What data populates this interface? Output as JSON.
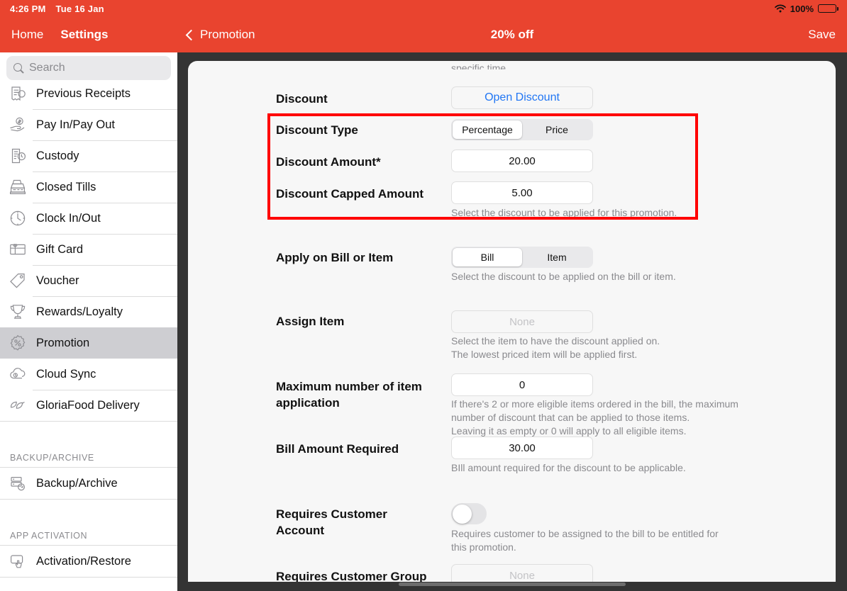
{
  "status_bar": {
    "time": "4:26 PM",
    "date": "Tue 16 Jan",
    "battery_percent": "100%",
    "wifi_icon": "wifi-icon",
    "battery_icon": "battery-full-icon"
  },
  "sidebar_header": {
    "home_label": "Home",
    "settings_label": "Settings"
  },
  "navbar": {
    "back_label": "Promotion",
    "back_icon": "chevron-left-icon",
    "title": "20% off",
    "save_label": "Save"
  },
  "search": {
    "placeholder": "Search",
    "icon": "search-icon",
    "value": ""
  },
  "sidebar": {
    "items": [
      {
        "label": "Previous Receipts",
        "icon": "receipt-icon",
        "selected": false
      },
      {
        "label": "Pay In/Pay Out",
        "icon": "hand-money-icon",
        "selected": false
      },
      {
        "label": "Custody",
        "icon": "document-clock-icon",
        "selected": false
      },
      {
        "label": "Closed Tills",
        "icon": "cash-register-icon",
        "selected": false
      },
      {
        "label": "Clock In/Out",
        "icon": "clock-icon",
        "selected": false
      },
      {
        "label": "Gift Card",
        "icon": "gift-card-icon",
        "selected": false
      },
      {
        "label": "Voucher",
        "icon": "tag-icon",
        "selected": false
      },
      {
        "label": "Rewards/Loyalty",
        "icon": "trophy-icon",
        "selected": false
      },
      {
        "label": "Promotion",
        "icon": "percent-badge-icon",
        "selected": true
      },
      {
        "label": "Cloud Sync",
        "icon": "cloud-sync-icon",
        "selected": false
      },
      {
        "label": "GloriaFood Delivery",
        "icon": "leaf-icon",
        "selected": false
      }
    ],
    "groups": [
      {
        "title": "BACKUP/ARCHIVE",
        "items": [
          {
            "label": "Backup/Archive",
            "icon": "server-backup-icon",
            "selected": false
          }
        ]
      },
      {
        "title": "APP ACTIVATION",
        "items": [
          {
            "label": "Activation/Restore",
            "icon": "tap-screen-icon",
            "selected": false
          }
        ]
      }
    ]
  },
  "form": {
    "clipped_top_text": "specific time.",
    "discount": {
      "label": "Discount",
      "button_label": "Open Discount"
    },
    "discount_type": {
      "label": "Discount Type",
      "options": [
        "Percentage",
        "Price"
      ],
      "selected": "Percentage"
    },
    "discount_amount": {
      "label": "Discount Amount*",
      "value": "20.00"
    },
    "discount_capped_amount": {
      "label": "Discount Capped Amount",
      "value": "5.00",
      "hint": "Select the discount to be applied for this promotion."
    },
    "apply_on": {
      "label": "Apply on Bill or Item",
      "options": [
        "Bill",
        "Item"
      ],
      "selected": "Bill",
      "hint": "Select the discount to be applied on the bill or item."
    },
    "assign_item": {
      "label": "Assign Item",
      "value": "None",
      "hint": "Select the item to have the discount applied on.\nThe lowest priced item will be applied first."
    },
    "max_item_application": {
      "label": "Maximum number of item application",
      "value": "0",
      "hint": "If there's 2 or more eligible items ordered in the bill, the maximum\nnumber of discount that can be applied to those items.\nLeaving it as empty or 0 will apply to all eligible items."
    },
    "bill_amount_required": {
      "label": "Bill Amount Required",
      "value": "30.00",
      "hint": "BIll amount required for the discount to be applicable."
    },
    "requires_customer_account": {
      "label": "Requires Customer Account",
      "toggle_on": false,
      "hint": "Requires customer to be assigned to the bill to be entitled for\nthis promotion."
    },
    "requires_customer_group": {
      "label": "Requires Customer Group",
      "value": "None"
    }
  },
  "annotation": {
    "color": "#FF0000",
    "highlighted_fields": [
      "Discount Type",
      "Discount Amount*",
      "Discount Capped Amount"
    ]
  },
  "colors": {
    "accent_red": "#E9442F",
    "link_blue": "#2176F4",
    "backdrop": "#343434",
    "card_bg": "#F7F7F7",
    "annotation_red": "#FF0000"
  }
}
